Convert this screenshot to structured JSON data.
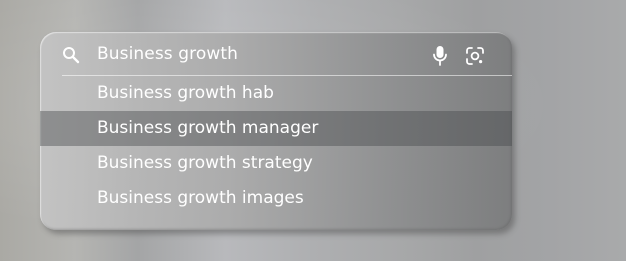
{
  "search": {
    "query": "Business growth",
    "search_icon": "search-icon",
    "voice_icon": "microphone-icon",
    "image_search_icon": "lens-icon"
  },
  "suggestions": [
    {
      "label": "Business growth hab",
      "highlighted": false
    },
    {
      "label": "Business growth manager",
      "highlighted": true
    },
    {
      "label": "Business growth strategy",
      "highlighted": false
    },
    {
      "label": "Business growth images",
      "highlighted": false
    }
  ],
  "colors": {
    "text": "#ffffff",
    "highlight": "#5f6163"
  }
}
